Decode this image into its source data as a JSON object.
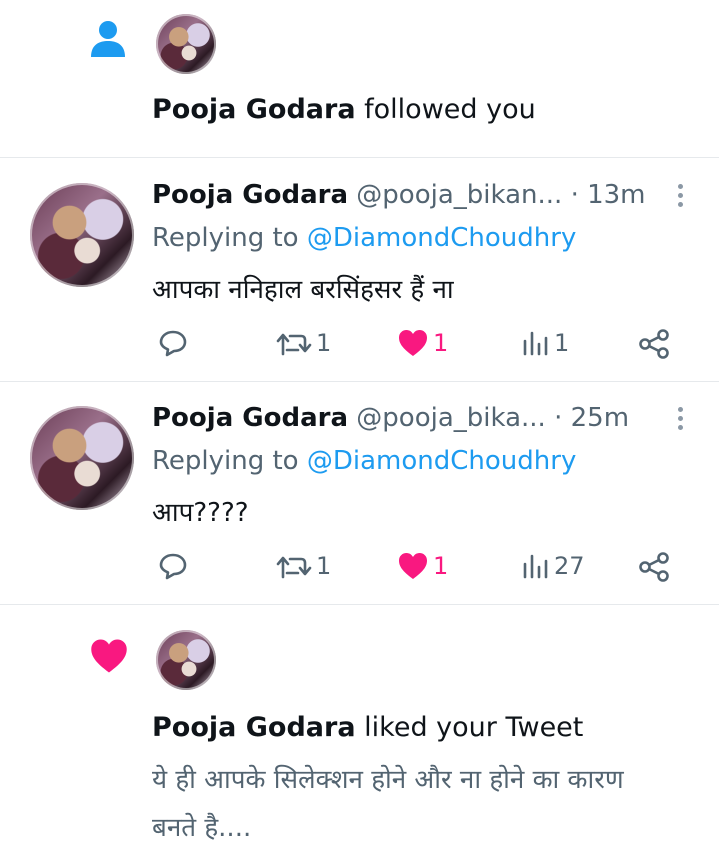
{
  "notifications": {
    "follow": {
      "name": "Pooja Godara",
      "action_text": "followed you"
    },
    "like": {
      "name": "Pooja Godara",
      "action_text": "liked your Tweet",
      "tweet_line1": "ये ही आपके सिलेक्शन होने और ना होने का कारण",
      "tweet_line2": "बनते है...."
    }
  },
  "tweets": [
    {
      "name": "Pooja Godara",
      "handle": "@pooja_bikan...",
      "time": "· 13m",
      "replying_prefix": "Replying to",
      "replying_to": "@DiamondChoudhry",
      "text": "आपका ननिहाल बरसिंहसर हैं ना",
      "retweets": "1",
      "likes": "1",
      "views": "1"
    },
    {
      "name": "Pooja Godara",
      "handle": "@pooja_bika...",
      "time": "· 25m",
      "replying_prefix": "Replying to",
      "replying_to": "@DiamondChoudhry",
      "text": "आप????",
      "retweets": "1",
      "likes": "1",
      "views": "27"
    }
  ],
  "icons": {
    "follow": "person-icon",
    "like": "heart-icon",
    "reply": "reply-icon",
    "retweet": "retweet-icon",
    "liked": "heart-filled-icon",
    "views": "views-icon",
    "share": "share-icon",
    "more": "more-vertical-icon"
  },
  "colors": {
    "accent": "#1d9bf0",
    "like": "#f91880",
    "secondary": "#536471"
  }
}
